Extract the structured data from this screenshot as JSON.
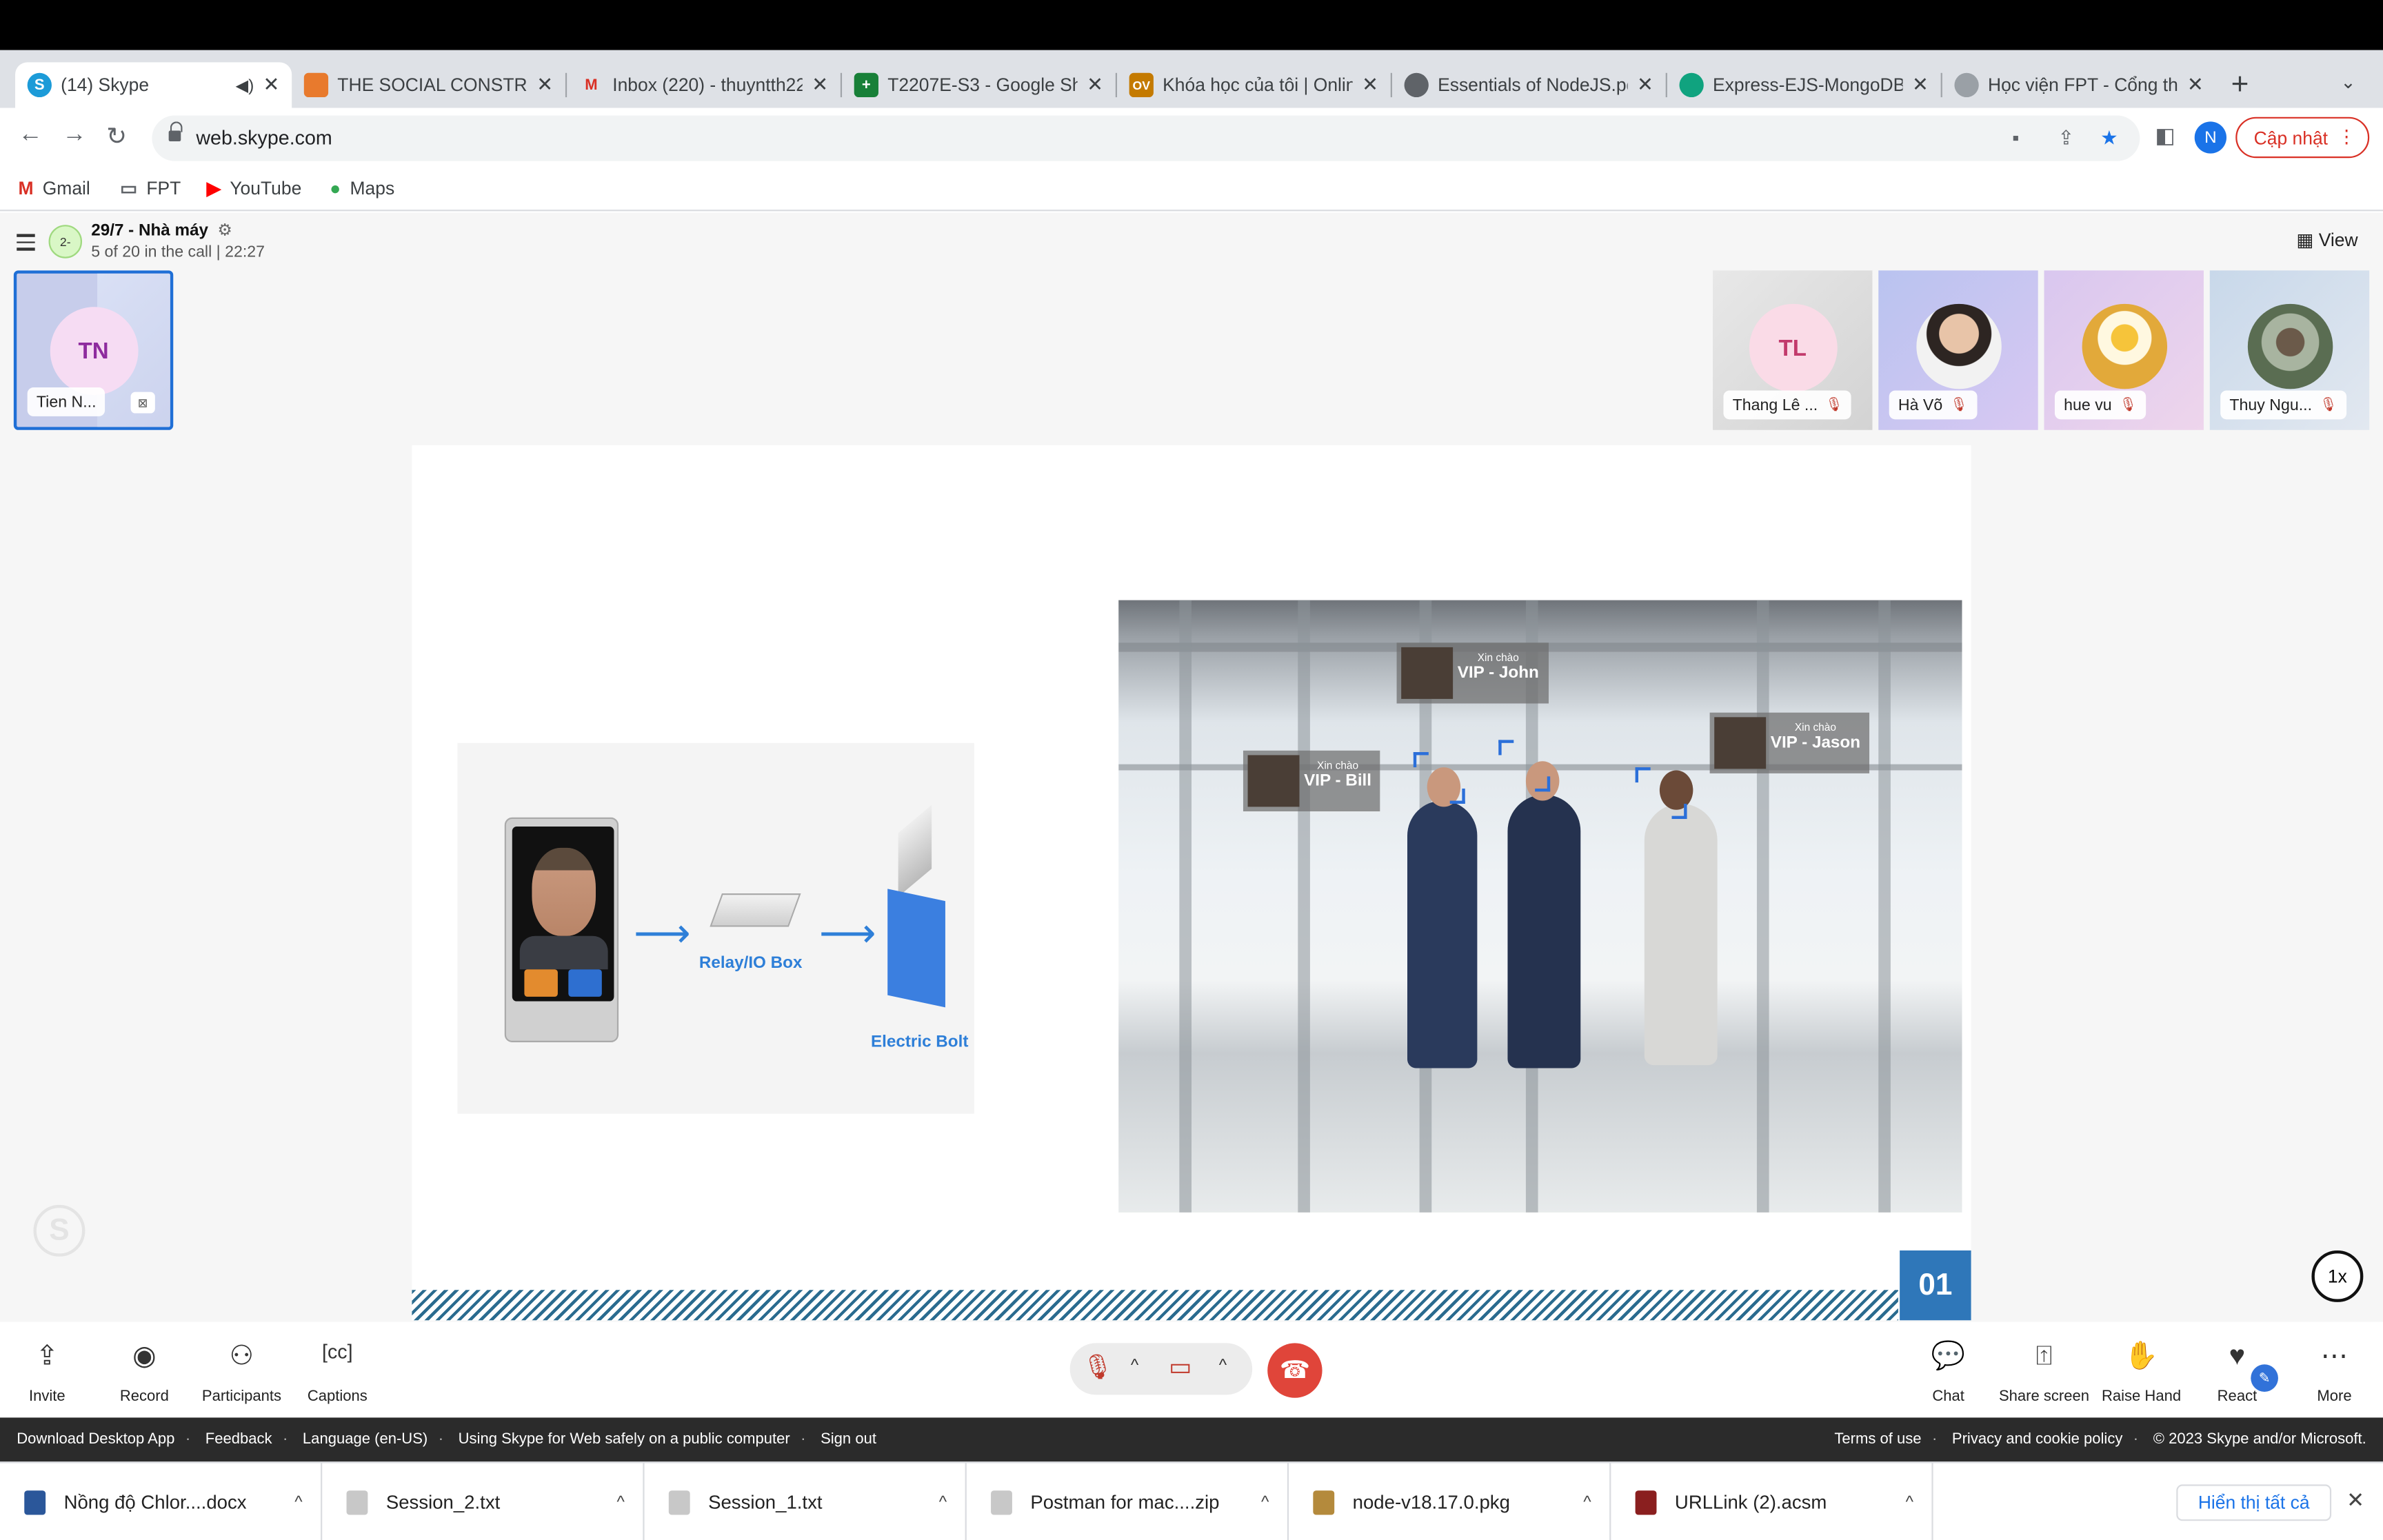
{
  "browser": {
    "tabs": [
      {
        "title": "(14) Skype",
        "active": true,
        "favicon_color": "#1c9bd8"
      },
      {
        "title": "THE SOCIAL CONSTRUC",
        "favicon_color": "#e87a2d"
      },
      {
        "title": "Inbox (220) - thuyntth22",
        "favicon_color": "#d93025"
      },
      {
        "title": "T2207E-S3 - Google Sh",
        "favicon_color": "#188038"
      },
      {
        "title": "Khóa học của tôi | Online",
        "favicon_color": "#c47a00"
      },
      {
        "title": "Essentials of NodeJS.pd",
        "favicon_color": "#5f6368"
      },
      {
        "title": "Express-EJS-MongoDB",
        "favicon_color": "#10a37f"
      },
      {
        "title": "Học viện FPT - Cổng thô",
        "favicon_color": "#9aa0a6"
      }
    ],
    "address": "web.skype.com",
    "profile_initial": "N",
    "update_label": "Cập nhật",
    "bookmarks": [
      "Gmail",
      "FPT",
      "YouTube",
      "Maps"
    ]
  },
  "call": {
    "avatar_text": "2-",
    "title": "29/7 - Nhà máy",
    "subtitle": "5 of 20 in the call | 22:27",
    "view_label": "View",
    "self": {
      "initials": "TN",
      "name": "Tien N..."
    },
    "participants": [
      {
        "initials": "TL",
        "name": "Thang Lê ..."
      },
      {
        "name": "Hà Võ"
      },
      {
        "name": "hue vu"
      },
      {
        "name": "Thuy Ngu..."
      }
    ]
  },
  "slide": {
    "relay_label": "Relay/IO Box",
    "bolt_label": "Electric Bolt",
    "vip_greeting": "Xin chào",
    "vips": [
      "VIP - John",
      "VIP - Bill",
      "VIP - Jason"
    ],
    "slide_number": "01",
    "speed": "1x"
  },
  "controls": {
    "left": [
      {
        "label": "Invite",
        "icon": "share-icon"
      },
      {
        "label": "Record",
        "icon": "record-icon"
      },
      {
        "label": "Participants",
        "icon": "participants-icon"
      },
      {
        "label": "Captions",
        "icon": "captions-icon"
      }
    ],
    "right": [
      {
        "label": "Chat",
        "icon": "chat-icon"
      },
      {
        "label": "Share screen",
        "icon": "share-screen-icon"
      },
      {
        "label": "Raise Hand",
        "icon": "hand-icon"
      },
      {
        "label": "React",
        "icon": "heart-icon"
      },
      {
        "label": "More",
        "icon": "more-icon"
      }
    ]
  },
  "footer": {
    "left": [
      "Download Desktop App",
      "Feedback",
      "Language (en-US)",
      "Using Skype for Web safely on a public computer",
      "Sign out"
    ],
    "right": [
      "Terms of use",
      "Privacy and cookie policy",
      "© 2023 Skype and/or Microsoft."
    ]
  },
  "downloads": {
    "items": [
      {
        "name": "Nồng độ Chlor....docx",
        "color": "#2b579a"
      },
      {
        "name": "Session_2.txt",
        "color": "#c8c8c8"
      },
      {
        "name": "Session_1.txt",
        "color": "#c8c8c8"
      },
      {
        "name": "Postman for mac....zip",
        "color": "#c8c8c8"
      },
      {
        "name": "node-v18.17.0.pkg",
        "color": "#b48a3c"
      },
      {
        "name": "URLLink (2).acsm",
        "color": "#8a1f1f"
      }
    ],
    "show_all": "Hiển thị tất cả"
  }
}
